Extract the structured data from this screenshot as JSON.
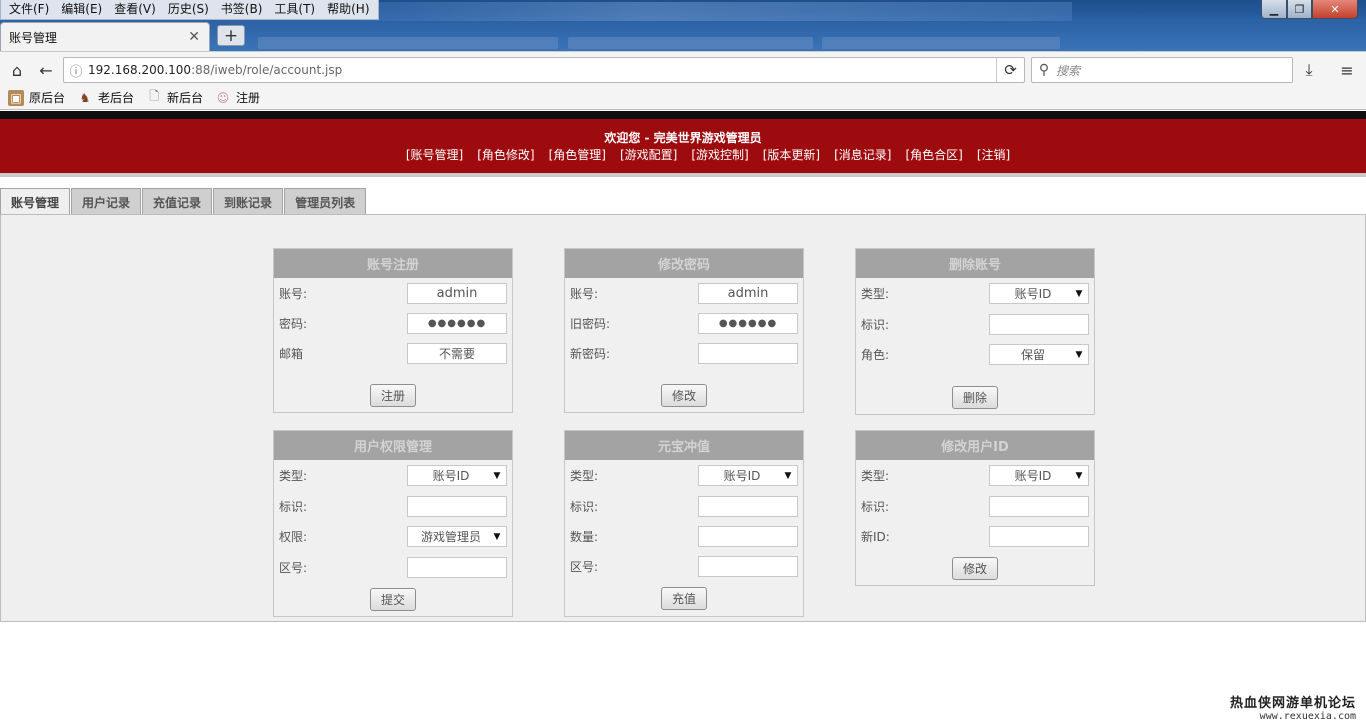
{
  "browser": {
    "menu": [
      "文件(F)",
      "编辑(E)",
      "查看(V)",
      "历史(S)",
      "书签(B)",
      "工具(T)",
      "帮助(H)"
    ],
    "tab_title": "账号管理",
    "url_host": "192.168.200.100",
    "url_rest": ":88/iweb/role/account.jsp",
    "search_placeholder": "搜索",
    "bookmarks": [
      "原后台",
      "老后台",
      "新后台",
      "注册"
    ]
  },
  "header": {
    "welcome": "欢迎您  - 完美世界游戏管理员",
    "links": [
      "[账号管理]",
      "[角色修改]",
      "[角色管理]",
      "[游戏配置]",
      "[游戏控制]",
      "[版本更新]",
      "[消息记录]",
      "[角色合区]",
      "[注销]"
    ]
  },
  "tabs": [
    "账号管理",
    "用户记录",
    "充值记录",
    "到账记录",
    "管理员列表"
  ],
  "panels": {
    "register": {
      "title": "账号注册",
      "account_label": "账号:",
      "account_value": "admin",
      "password_label": "密码:",
      "password_value": "●●●●●●",
      "email_label": "邮箱",
      "email_value": "不需要",
      "button": "注册"
    },
    "change_password": {
      "title": "修改密码",
      "account_label": "账号:",
      "account_value": "admin",
      "old_label": "旧密码:",
      "old_value": "●●●●●●",
      "new_label": "新密码:",
      "new_value": "",
      "button": "修改"
    },
    "delete_account": {
      "title": "删除账号",
      "type_label": "类型:",
      "type_value": "账号ID",
      "id_label": "标识:",
      "id_value": "",
      "role_label": "角色:",
      "role_value": "保留",
      "button": "删除"
    },
    "permissions": {
      "title": "用户权限管理",
      "type_label": "类型:",
      "type_value": "账号ID",
      "id_label": "标识:",
      "id_value": "",
      "perm_label": "权限:",
      "perm_value": "游戏管理员",
      "zone_label": "区号:",
      "zone_value": "",
      "button": "提交"
    },
    "recharge": {
      "title": "元宝冲值",
      "type_label": "类型:",
      "type_value": "账号ID",
      "id_label": "标识:",
      "id_value": "",
      "amount_label": "数量:",
      "amount_value": "",
      "zone_label": "区号:",
      "zone_value": "",
      "button": "充值"
    },
    "change_id": {
      "title": "修改用户ID",
      "type_label": "类型:",
      "type_value": "账号ID",
      "id_label": "标识:",
      "id_value": "",
      "newid_label": "新ID:",
      "newid_value": "",
      "button": "修改"
    }
  },
  "watermark": {
    "line1": "热血侠网游单机论坛",
    "line2": "www.rexuexia.com"
  },
  "colors": {
    "header_red": "#9e0b0f",
    "panel_header": "#a3a3a3",
    "content_bg": "#efefef"
  }
}
